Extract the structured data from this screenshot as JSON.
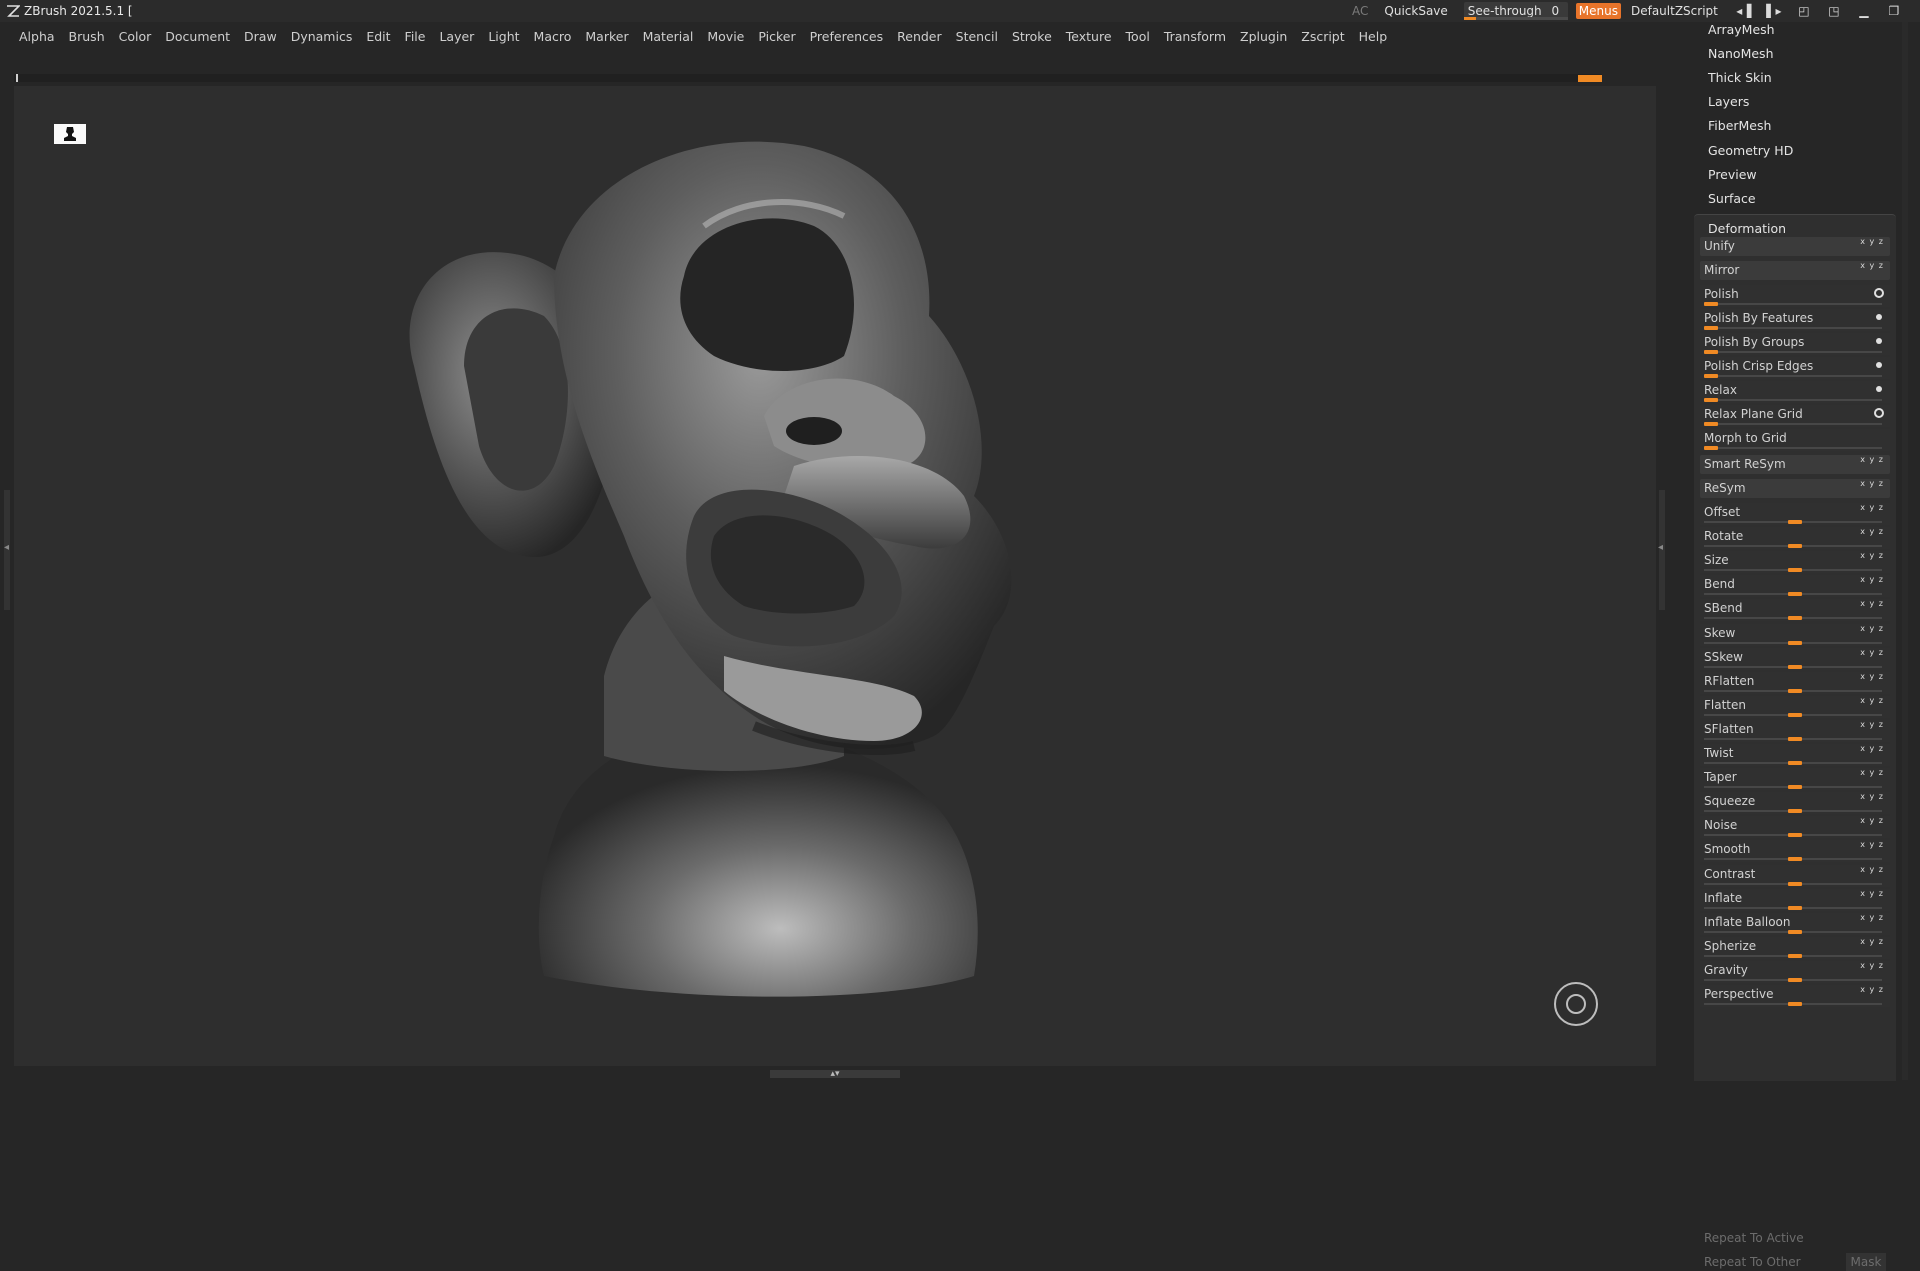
{
  "titlebar": {
    "app_title": "ZBrush 2021.5.1 [",
    "ac_label": "AC",
    "quicksave_label": "QuickSave",
    "seethrough_label": "See-through",
    "seethrough_value": "0",
    "seethrough_fraction": 0.0,
    "menus_label": "Menus",
    "zscript_label": "DefaultZScript"
  },
  "menubar": {
    "items": [
      "Alpha",
      "Brush",
      "Color",
      "Document",
      "Draw",
      "Dynamics",
      "Edit",
      "File",
      "Layer",
      "Light",
      "Macro",
      "Marker",
      "Material",
      "Movie",
      "Picker",
      "Preferences",
      "Render",
      "Stencil",
      "Stroke",
      "Texture",
      "Tool",
      "Transform",
      "Zplugin",
      "Zscript",
      "Help"
    ]
  },
  "palette": {
    "subpalettes": [
      "ArrayMesh",
      "NanoMesh",
      "Thick Skin",
      "Layers",
      "FiberMesh",
      "Geometry HD",
      "Preview",
      "Surface"
    ],
    "deformation": {
      "title": "Deformation",
      "buttons": [
        {
          "label": "Unify",
          "axes": "x y z"
        },
        {
          "label": "Mirror",
          "axes": "x y z"
        }
      ],
      "polish_sliders": [
        {
          "label": "Polish",
          "marker": "ring"
        },
        {
          "label": "Polish By Features",
          "marker": "dot"
        },
        {
          "label": "Polish By Groups",
          "marker": "dot"
        },
        {
          "label": "Polish Crisp Edges",
          "marker": "dot"
        },
        {
          "label": "Relax",
          "marker": "dot"
        },
        {
          "label": "Relax Plane Grid",
          "marker": "ring"
        },
        {
          "label": "Morph to Grid",
          "marker": ""
        }
      ],
      "sym_buttons": [
        {
          "label": "Smart ReSym",
          "axes": "x y z"
        },
        {
          "label": "ReSym",
          "axes": "x y z"
        }
      ],
      "axis_sliders": [
        {
          "label": "Offset",
          "axes": "x y z"
        },
        {
          "label": "Rotate",
          "axes": "x y z"
        },
        {
          "label": "Size",
          "axes": "x y z"
        },
        {
          "label": "Bend",
          "axes": "x y z"
        },
        {
          "label": "SBend",
          "axes": "x y z"
        },
        {
          "label": "Skew",
          "axes": "x y z"
        },
        {
          "label": "SSkew",
          "axes": "x y z"
        },
        {
          "label": "RFlatten",
          "axes": "x y z"
        },
        {
          "label": "Flatten",
          "axes": "x y z"
        },
        {
          "label": "SFlatten",
          "axes": "x y z"
        },
        {
          "label": "Twist",
          "axes": "x y z"
        },
        {
          "label": "Taper",
          "axes": "x y z"
        },
        {
          "label": "Squeeze",
          "axes": "x y z"
        },
        {
          "label": "Noise",
          "axes": "x y z"
        },
        {
          "label": "Smooth",
          "axes": "x y z"
        },
        {
          "label": "Contrast",
          "axes": "x y z"
        },
        {
          "label": "Inflate",
          "axes": "x y z"
        },
        {
          "label": "Inflate Balloon",
          "axes": "x y z"
        },
        {
          "label": "Spherize",
          "axes": "x y z"
        },
        {
          "label": "Gravity",
          "axes": "x y z"
        },
        {
          "label": "Perspective",
          "axes": "x y z"
        }
      ],
      "repeat_to_active": "Repeat To Active",
      "repeat_to_other": "Repeat To Other",
      "mask_label": "Mask"
    }
  },
  "colors": {
    "accent": "#f08a24",
    "menus_button": "#e8742a",
    "background": "#262626",
    "viewport": "#2e2e2e"
  }
}
